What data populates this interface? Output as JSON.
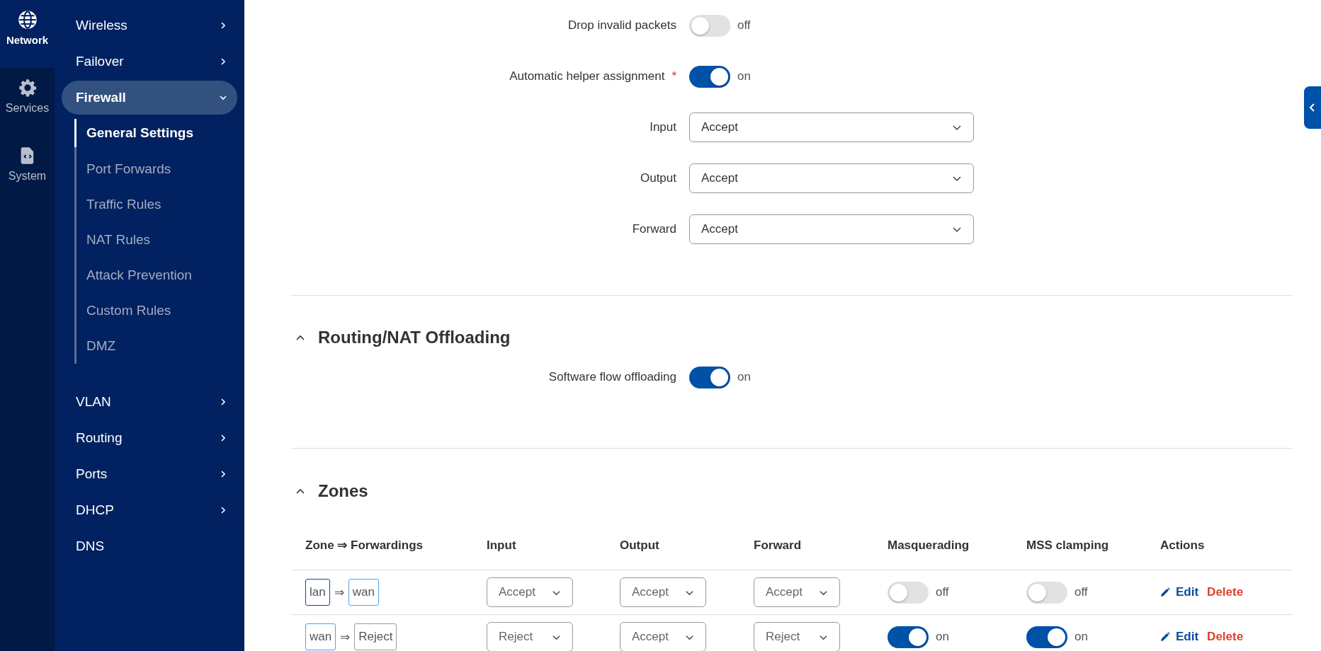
{
  "rail": [
    {
      "label": "Network",
      "kind": "globe",
      "selected": true
    },
    {
      "label": "Services",
      "kind": "gear",
      "selected": false
    },
    {
      "label": "System",
      "kind": "file",
      "selected": false
    }
  ],
  "menu": [
    {
      "label": "Wireless",
      "has_children": true,
      "expanded": false
    },
    {
      "label": "Failover",
      "has_children": true,
      "expanded": false
    },
    {
      "label": "Firewall",
      "has_children": true,
      "expanded": true,
      "children": [
        {
          "label": "General Settings",
          "selected": true
        },
        {
          "label": "Port Forwards",
          "selected": false
        },
        {
          "label": "Traffic Rules",
          "selected": false
        },
        {
          "label": "NAT Rules",
          "selected": false
        },
        {
          "label": "Attack Prevention",
          "selected": false
        },
        {
          "label": "Custom Rules",
          "selected": false
        },
        {
          "label": "DMZ",
          "selected": false
        }
      ]
    },
    {
      "label": "VLAN",
      "has_children": true,
      "expanded": false
    },
    {
      "label": "Routing",
      "has_children": true,
      "expanded": false
    },
    {
      "label": "Ports",
      "has_children": true,
      "expanded": false
    },
    {
      "label": "DHCP",
      "has_children": true,
      "expanded": false
    },
    {
      "label": "DNS",
      "has_children": false,
      "expanded": false
    }
  ],
  "settings": [
    {
      "label": "Drop invalid packets",
      "kind": "toggle",
      "required": false,
      "on": false,
      "state": "off"
    },
    {
      "label": "Automatic helper assignment",
      "kind": "toggle",
      "required": true,
      "required_mark": "*",
      "on": true,
      "state": "on"
    },
    {
      "label": "Input",
      "kind": "select",
      "required": false,
      "value": "Accept"
    },
    {
      "label": "Output",
      "kind": "select",
      "required": false,
      "value": "Accept"
    },
    {
      "label": "Forward",
      "kind": "select",
      "required": false,
      "value": "Accept"
    }
  ],
  "offloading": {
    "title": "Routing/NAT Offloading",
    "expanded": true,
    "settings": [
      {
        "label": "Software flow offloading",
        "kind": "toggle",
        "required": false,
        "on": true,
        "state": "on"
      }
    ]
  },
  "zones": {
    "title": "Zones",
    "expanded": true,
    "columns": [
      "Zone ⇒ Forwardings",
      "Input",
      "Output",
      "Forward",
      "Masquerading",
      "MSS clamping",
      "Actions"
    ],
    "rows": [
      {
        "zone": {
          "text": "lan",
          "color": "#0b4a9c"
        },
        "arrow": "⇒",
        "forward_to": {
          "text": "wan",
          "color": "#4aa3f0"
        },
        "input": "Accept",
        "output": "Accept",
        "forward": "Accept",
        "masquerading": {
          "on": false,
          "state": "off"
        },
        "mss_clamping": {
          "on": false,
          "state": "off"
        },
        "edit": "Edit",
        "delete": "Delete"
      },
      {
        "zone": {
          "text": "wan",
          "color": "#4aa3f0"
        },
        "arrow": "⇒",
        "forward_to": {
          "text": "Reject",
          "color": "#9a9a9a"
        },
        "input": "Reject",
        "output": "Accept",
        "forward": "Reject",
        "masquerading": {
          "on": true,
          "state": "on"
        },
        "mss_clamping": {
          "on": true,
          "state": "on"
        },
        "edit": "Edit",
        "delete": "Delete"
      }
    ]
  }
}
